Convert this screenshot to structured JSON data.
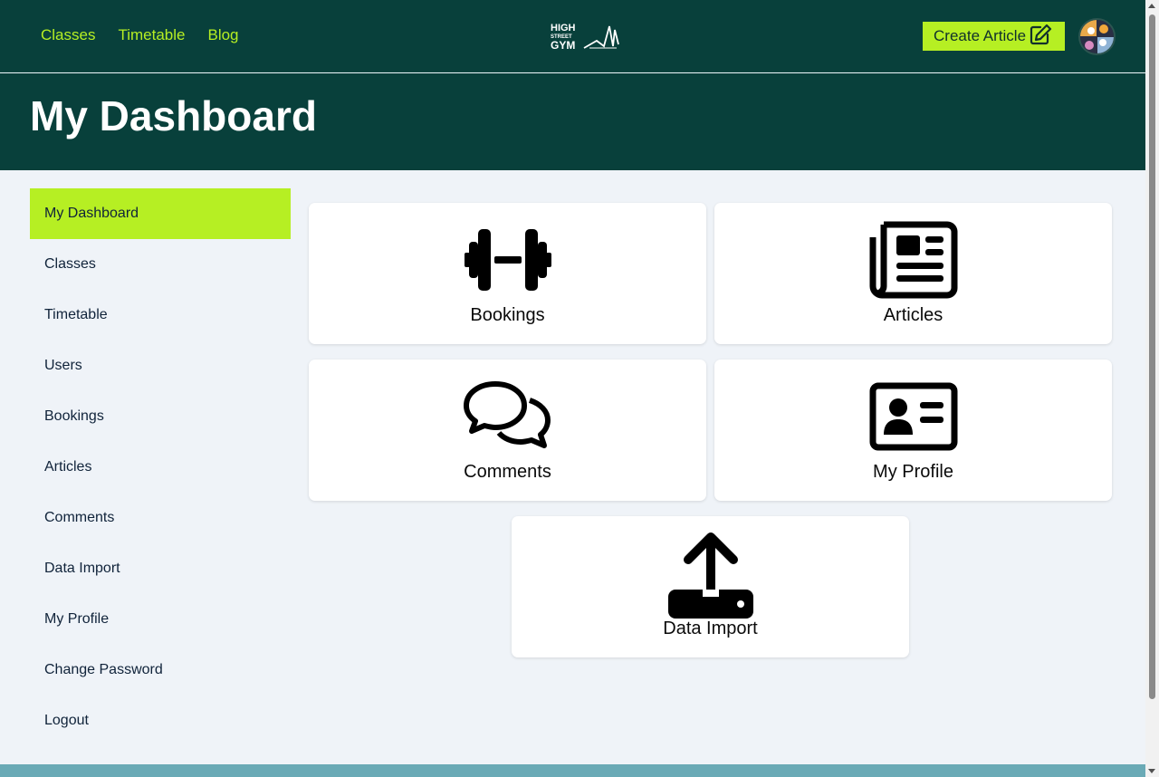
{
  "nav": {
    "links": [
      "Classes",
      "Timetable",
      "Blog"
    ],
    "logo_text": [
      "HIGH",
      "STREET",
      "GYM"
    ],
    "create_label": "Create Article"
  },
  "header": {
    "title": "My Dashboard"
  },
  "sidebar": {
    "items": [
      {
        "label": "My Dashboard",
        "active": true
      },
      {
        "label": "Classes"
      },
      {
        "label": "Timetable"
      },
      {
        "label": "Users"
      },
      {
        "label": "Bookings"
      },
      {
        "label": "Articles"
      },
      {
        "label": "Comments"
      },
      {
        "label": "Data Import"
      },
      {
        "label": "My Profile"
      },
      {
        "label": "Change Password"
      },
      {
        "label": "Logout"
      }
    ]
  },
  "cards": [
    {
      "label": "Bookings",
      "icon": "dumbbell-icon"
    },
    {
      "label": "Articles",
      "icon": "newspaper-icon"
    },
    {
      "label": "Comments",
      "icon": "comments-icon"
    },
    {
      "label": "My Profile",
      "icon": "id-card-icon"
    },
    {
      "label": "Data Import",
      "icon": "upload-icon"
    }
  ],
  "colors": {
    "primary_dark": "#08403b",
    "accent": "#b6ef23",
    "background": "#eff3f8",
    "footer": "#6aaab6"
  }
}
